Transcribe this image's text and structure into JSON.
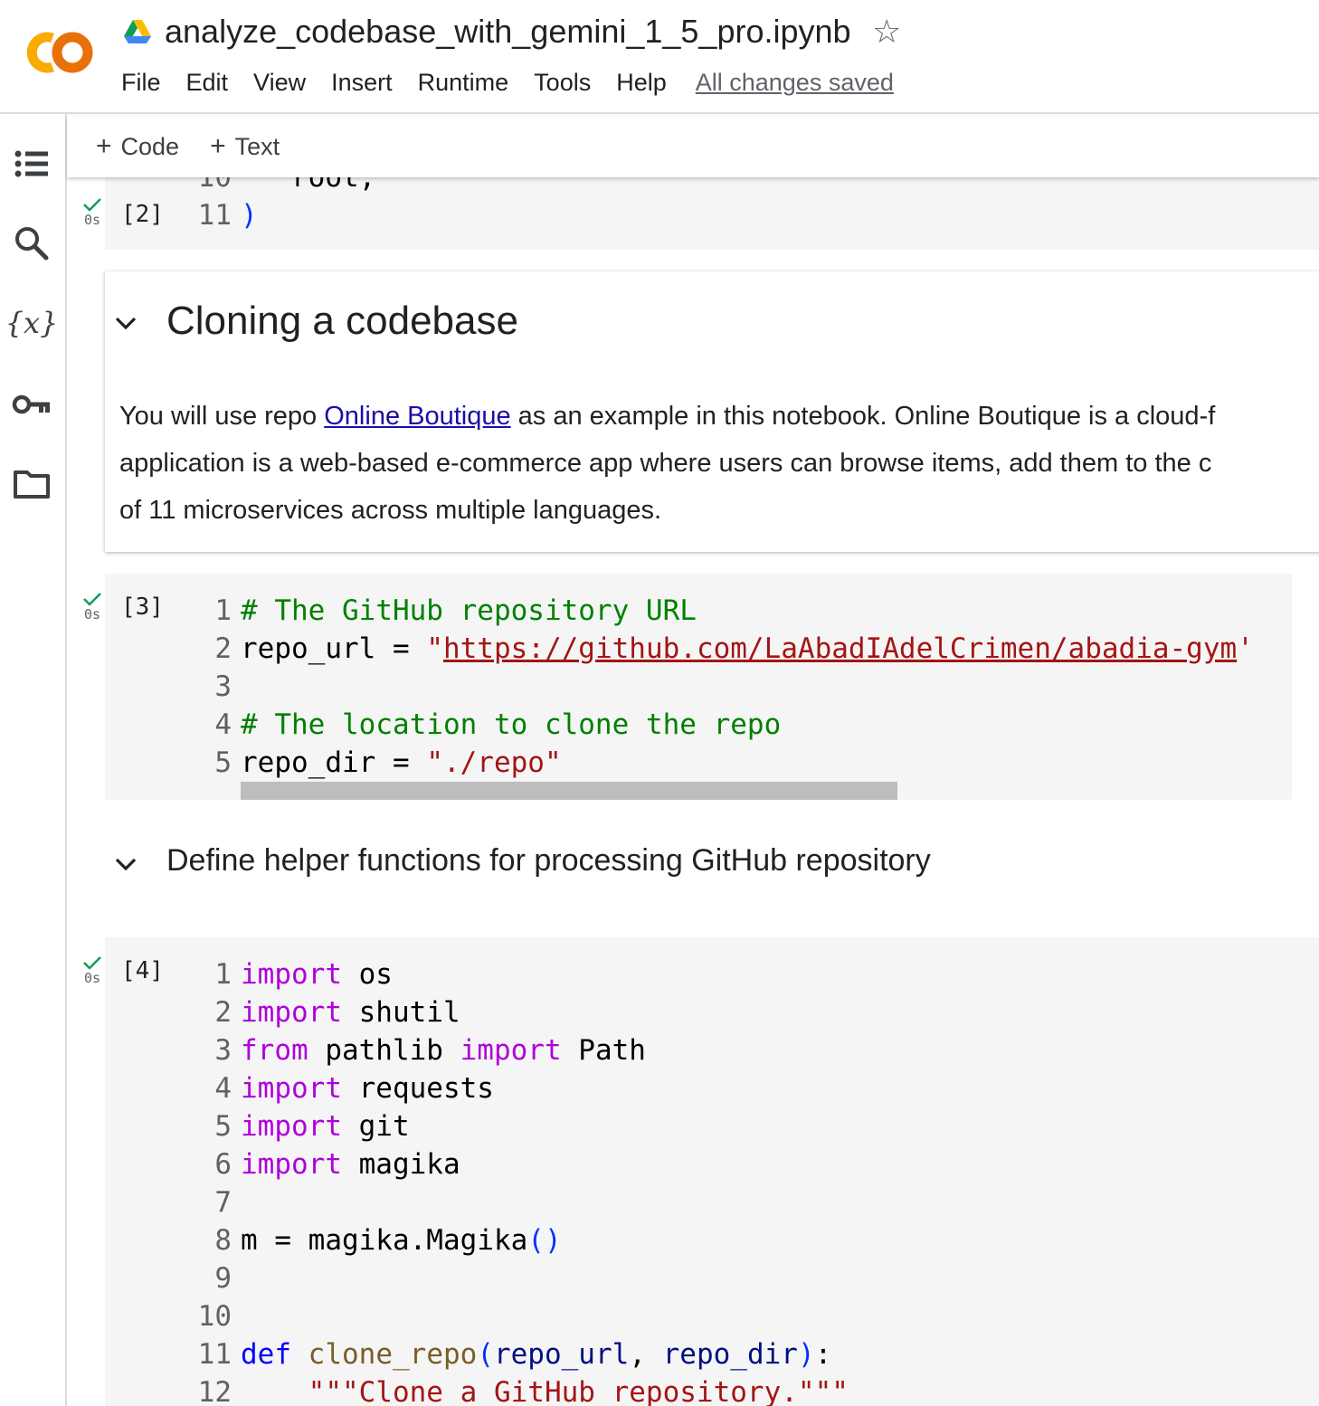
{
  "header": {
    "title": "analyze_codebase_with_gemini_1_5_pro.ipynb",
    "logo_text": "CO",
    "menu": [
      "File",
      "Edit",
      "View",
      "Insert",
      "Runtime",
      "Tools",
      "Help"
    ],
    "save_status": "All changes saved"
  },
  "left_rail": {
    "icons": [
      "table-of-contents-icon",
      "search-icon",
      "variables-icon",
      "secrets-key-icon",
      "files-folder-icon"
    ]
  },
  "toolbar": {
    "add_code_label": "Code",
    "add_text_label": "Text",
    "plus": "+"
  },
  "cells": {
    "cell2": {
      "exec_count": "[2]",
      "run_time": "0s",
      "partial_line_num": "10",
      "partial_line_code": "   root,",
      "last_line_num": "11",
      "last_line_code": ")"
    },
    "md1": {
      "heading": "Cloning a codebase",
      "para_prefix": "You will use repo ",
      "link_text": "Online Boutique",
      "line1_rest": " as an example in this notebook. Online Boutique is a cloud-f",
      "line2": "application is a web-based e-commerce app where users can browse items, add them to the c",
      "line3": "of 11 microservices across multiple languages."
    },
    "cell3": {
      "exec_count": "[3]",
      "run_time": "0s",
      "lines": [
        {
          "num": "1",
          "comment": "# The GitHub repository URL"
        },
        {
          "num": "2",
          "var": "repo_url = ",
          "q_open": "\"",
          "url": "https://github.com/LaAbadIAdelCrimen/abadia-gym",
          "q_close": "'"
        },
        {
          "num": "3"
        },
        {
          "num": "4",
          "comment": "# The location to clone the repo"
        },
        {
          "num": "5",
          "var": "repo_dir = ",
          "str": "\"./repo\""
        }
      ]
    },
    "md2": {
      "heading": "Define helper functions for processing GitHub repository"
    },
    "cell4": {
      "exec_count": "[4]",
      "run_time": "0s",
      "line_nums": [
        "1",
        "2",
        "3",
        "4",
        "5",
        "6",
        "7",
        "8",
        "9",
        "10",
        "11",
        "12"
      ],
      "kw_import": "import",
      "kw_from": "from",
      "kw_def": "def",
      "mod_os": " os",
      "mod_shutil": " shutil",
      "mod_pathlib": " pathlib ",
      "name_path": " Path",
      "mod_requests": " requests",
      "mod_git": " git",
      "mod_magika": " magika",
      "assign_m": "m = magika.Magika",
      "parens": "()",
      "fn_name": "clone_repo",
      "p_open": "(",
      "param1": "repo_url",
      "comma": ", ",
      "param2": "repo_dir",
      "p_close": ")",
      "colon": ":",
      "indent": "    ",
      "docstring": "\"\"\"Clone a GitHub repository.\"\"\""
    }
  },
  "colors": {
    "comment": "#008000",
    "string": "#a31515",
    "keyword": "#af00db",
    "def_keyword": "#0000ff",
    "run_check": "#0f9d58",
    "link": "#1a0dab",
    "logo_left": "#f9ab00",
    "logo_right": "#e8710a"
  }
}
